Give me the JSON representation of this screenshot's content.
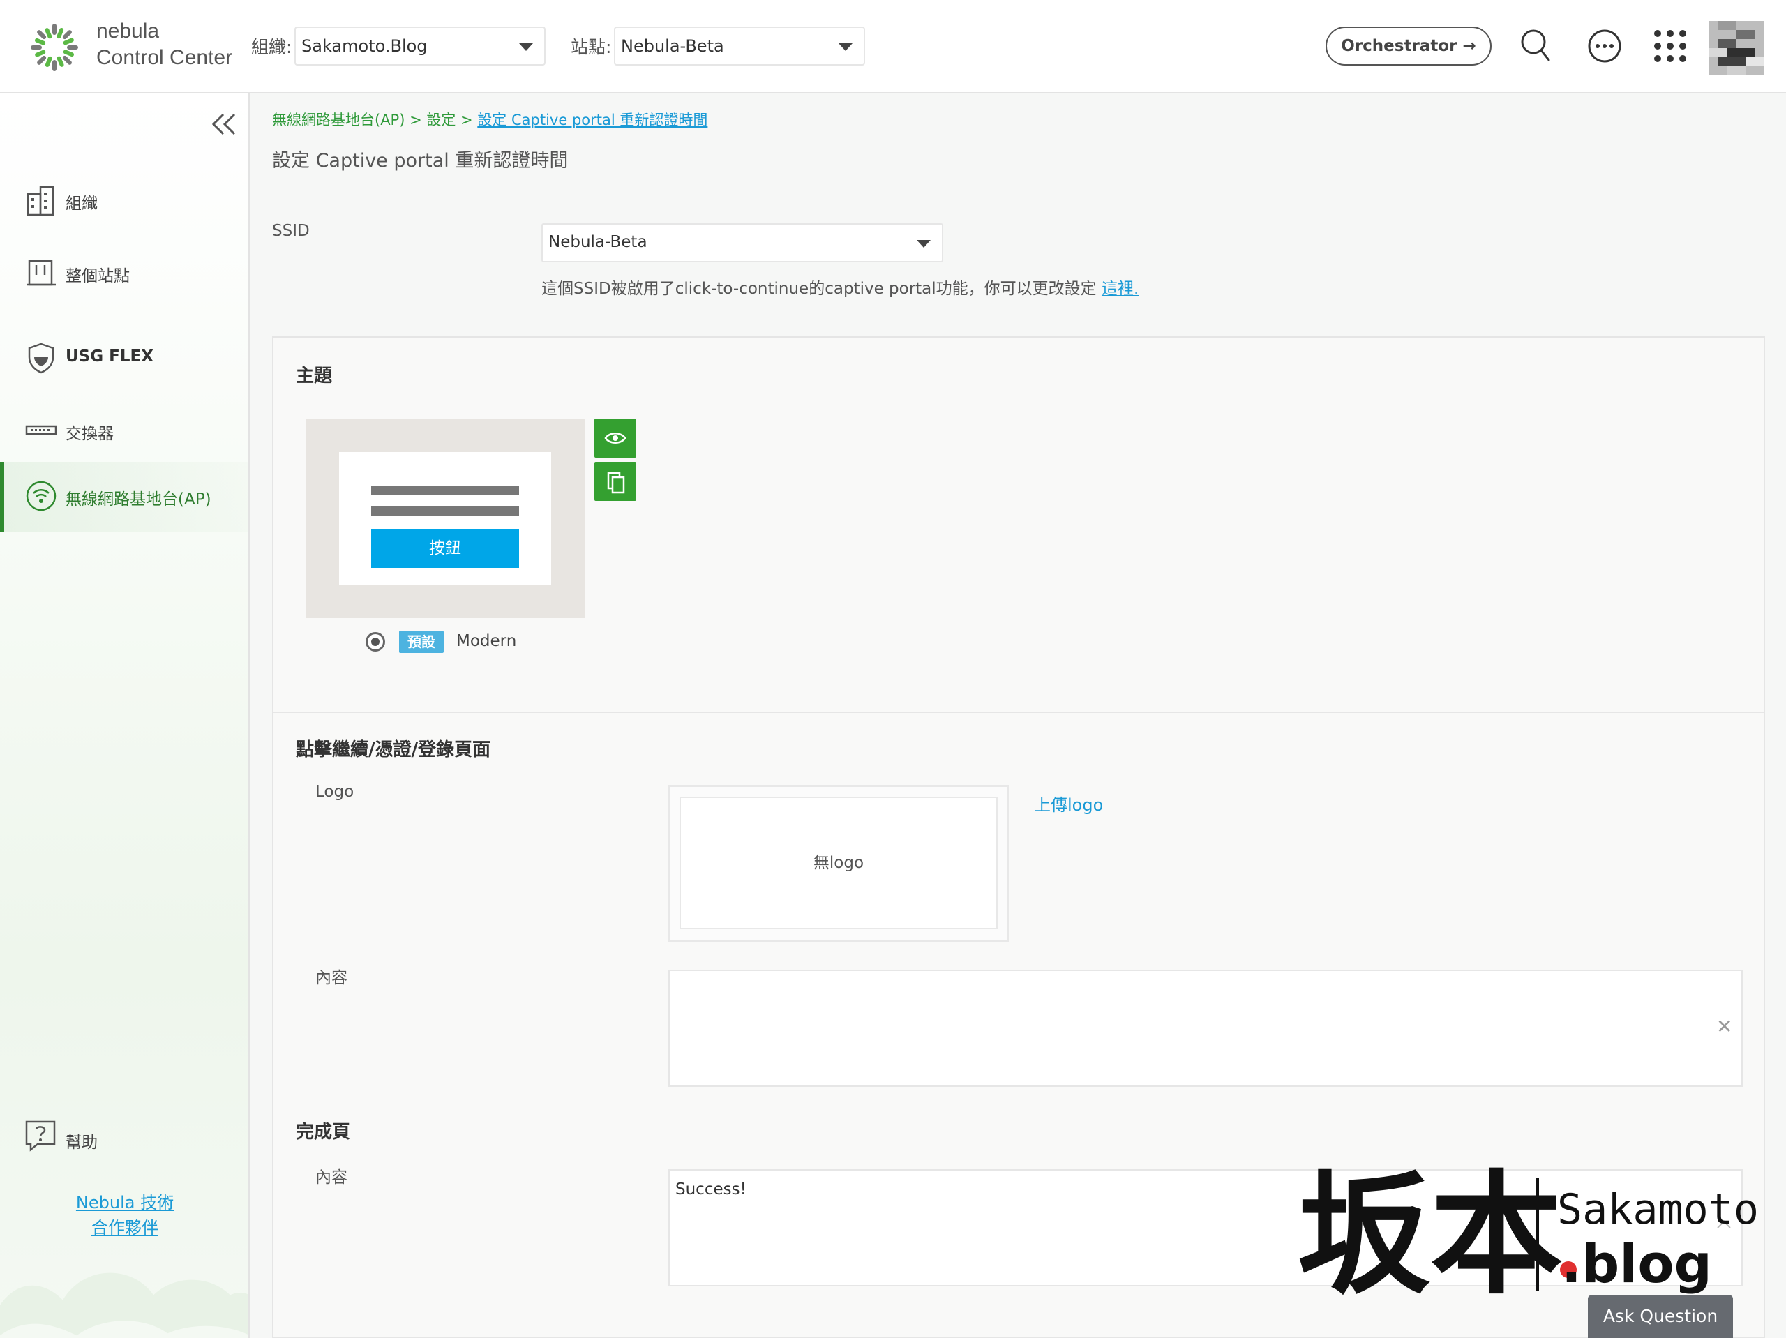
{
  "brand": {
    "line1": "nebula",
    "line2": "Control Center"
  },
  "header": {
    "org_label": "組織:",
    "org_value": "Sakamoto.Blog",
    "site_label": "站點:",
    "site_value": "Nebula-Beta",
    "orchestrator_label": "Orchestrator →"
  },
  "sidebar": {
    "items": [
      {
        "label": "組織"
      },
      {
        "label": "整個站點"
      },
      {
        "label": "USG FLEX"
      },
      {
        "label": "交換器"
      },
      {
        "label": "無線網路基地台(AP)"
      }
    ],
    "help_label": "幫助",
    "partner_line1": "Nebula 技術",
    "partner_line2": "合作夥伴"
  },
  "breadcrumb": {
    "part1": "無線網路基地台(AP) > 設定 > ",
    "current": "設定 Captive portal 重新認證時間"
  },
  "page": {
    "title": "設定 Captive portal 重新認證時間",
    "ssid_label": "SSID",
    "ssid_value": "Nebula-Beta",
    "ssid_note": "這個SSID被啟用了click-to-continue的captive portal功能，你可以更改設定 ",
    "ssid_note_link": "這裡."
  },
  "theme": {
    "title": "主題",
    "demo_button": "按鈕",
    "default_badge": "預設",
    "name": "Modern"
  },
  "login_page": {
    "title": "點擊繼續/憑證/登錄頁面",
    "logo_label": "Logo",
    "no_logo": "無logo",
    "upload_link": "上傳logo",
    "content_label": "內容",
    "content_value": ""
  },
  "success_page": {
    "title": "完成頁",
    "content_label": "內容",
    "content_value": "Success!"
  },
  "watermark": {
    "kanji": "坂本",
    "name": "Sakamoto",
    "suffix": ".blog"
  },
  "ask_question": "Ask Question",
  "colors": {
    "accent_green": "#34a030",
    "link_blue": "#1a9ad6",
    "demo_button_blue": "#00a6e8"
  }
}
